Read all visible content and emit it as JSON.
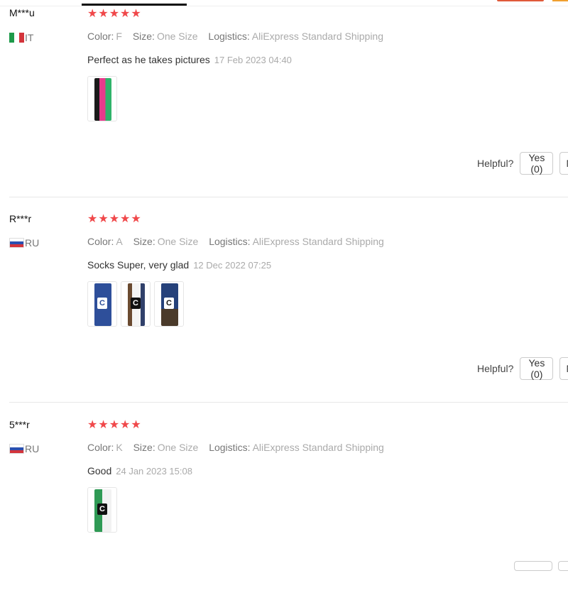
{
  "reviews": [
    {
      "user": "M***u",
      "country_code": "IT",
      "country_flag": "flag-italy",
      "rating": 5,
      "color_label": "Color:",
      "color_value": "F",
      "size_label": "Size:",
      "size_value": "One Size",
      "logistics_label": "Logistics:",
      "logistics_value": "AliExpress Standard Shipping",
      "text": "Perfect as he takes pictures",
      "date": "17 Feb 2023 04:40",
      "photos": 1,
      "helpful_label": "Helpful?",
      "yes_label": "Yes (0)",
      "no_label": "N"
    },
    {
      "user": "R***r",
      "country_code": "RU",
      "country_flag": "flag-russia",
      "rating": 5,
      "color_label": "Color:",
      "color_value": "A",
      "size_label": "Size:",
      "size_value": "One Size",
      "logistics_label": "Logistics:",
      "logistics_value": "AliExpress Standard Shipping",
      "text": "Socks Super, very glad",
      "date": "12 Dec 2022 07:25",
      "photos": 3,
      "helpful_label": "Helpful?",
      "yes_label": "Yes (0)",
      "no_label": "N"
    },
    {
      "user": "5***r",
      "country_code": "RU",
      "country_flag": "flag-russia",
      "rating": 5,
      "color_label": "Color:",
      "color_value": "K",
      "size_label": "Size:",
      "size_value": "One Size",
      "logistics_label": "Logistics:",
      "logistics_value": "AliExpress Standard Shipping",
      "text": "Good",
      "date": "24 Jan 2023 15:08",
      "photos": 1
    }
  ],
  "colors": {
    "star": "#f0484a",
    "accent": "#e05a3a"
  }
}
